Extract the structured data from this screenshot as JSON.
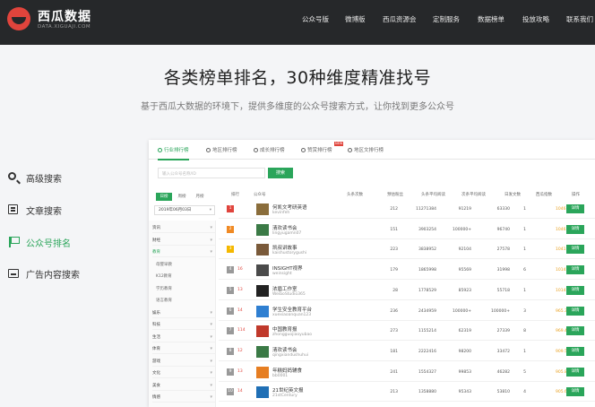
{
  "brand": {
    "name": "西瓜数据",
    "sub": "DATA.XIGUAJI.COM"
  },
  "nav": [
    "公众号版",
    "微博版",
    "西瓜资源会",
    "定制服务",
    "数据榜单",
    "投放攻略",
    "联系我们"
  ],
  "headline": "各类榜单排名，30种维度精准找号",
  "subline": "基于西瓜大数据的环境下，提供多维度的公众号搜索方式，让你找到更多公众号",
  "side_menu": [
    {
      "label": "高级搜索",
      "icon": "search-icon"
    },
    {
      "label": "文章搜索",
      "icon": "article-icon"
    },
    {
      "label": "公众号排名",
      "icon": "flag-icon",
      "active": true
    },
    {
      "label": "广告内容搜索",
      "icon": "ad-icon"
    }
  ],
  "panel": {
    "tabs": [
      "行业排行榜",
      "地区排行榜",
      "成长排行榜",
      "赞赏排行榜",
      "地区文排行榜"
    ],
    "hot_badge": "NEW",
    "search_placeholder": "输入公众号名称/ID",
    "search_button": "搜索",
    "period_tabs": [
      "日榜",
      "周榜",
      "月榜"
    ],
    "date": "2019年06月03日",
    "categories": [
      {
        "label": "资讯",
        "type": "cat"
      },
      {
        "label": "财经",
        "type": "cat"
      },
      {
        "label": "教育",
        "type": "cat",
        "active": true
      },
      {
        "label": "母婴早教",
        "type": "sub"
      },
      {
        "label": "K12教育",
        "type": "sub"
      },
      {
        "label": "学历教育",
        "type": "sub"
      },
      {
        "label": "语言教育",
        "type": "sub"
      },
      {
        "label": "娱乐",
        "type": "cat"
      },
      {
        "label": "科技",
        "type": "cat"
      },
      {
        "label": "生活",
        "type": "cat"
      },
      {
        "label": "体育",
        "type": "cat"
      },
      {
        "label": "游戏",
        "type": "cat"
      },
      {
        "label": "文化",
        "type": "cat"
      },
      {
        "label": "美食",
        "type": "cat"
      },
      {
        "label": "情感",
        "type": "cat"
      }
    ],
    "columns": [
      "排行",
      "公众号",
      "头条次数",
      "预估粉丝",
      "头条平均阅读",
      "次条平均阅读",
      "日发文数",
      "西瓜指数",
      "操作"
    ],
    "rows": [
      {
        "rank": "1",
        "rank_color": "#e0443c",
        "name": "何凯文考研英语",
        "wx": "kevinfeh",
        "v1": "212",
        "v2": "11271384",
        "v3": "91219",
        "v4": "63330",
        "v5": "1",
        "idx": "1046.8",
        "av": "#8a6d3b"
      },
      {
        "rank": "2",
        "rank_color": "#f08a24",
        "name": "清欢读书会",
        "wx": "lingyugamn07",
        "v1": "151",
        "v2": "3903254",
        "v3": "100000+",
        "v4": "96740",
        "v5": "1",
        "idx": "1046.9",
        "av": "#3b7a46"
      },
      {
        "rank": "3",
        "rank_color": "#f5b800",
        "name": "凯叔讲故事",
        "wx": "kaishustorygushi",
        "v1": "223",
        "v2": "3838952",
        "v3": "92104",
        "v4": "27578",
        "v5": "1",
        "idx": "1041.1",
        "av": "#7a5a3a"
      },
      {
        "rank": "4",
        "rank_color": "#999999",
        "change": "16",
        "name": "INSIGHT视界",
        "wx": "weinsight",
        "v1": "179",
        "v2": "1865998",
        "v3": "95569",
        "v4": "31998",
        "v5": "6",
        "idx": "1014.0",
        "av": "#4a4a4a"
      },
      {
        "rank": "5",
        "rank_color": "#999999",
        "change": "13",
        "name": "浓眉工作室",
        "wx": "WeiboStudio365",
        "v1": "28",
        "v2": "1778529",
        "v3": "85923",
        "v4": "55718",
        "v5": "1",
        "idx": "1014.0",
        "av": "#222222"
      },
      {
        "rank": "6",
        "rank_color": "#999999",
        "change": "14",
        "name": "学生安全教育平台",
        "wx": "xuexiaoanquan123",
        "v1": "236",
        "v2": "2434959",
        "v3": "100000+",
        "v4": "100000+",
        "v5": "3",
        "idx": "965.3",
        "av": "#2f7fd1"
      },
      {
        "rank": "7",
        "rank_color": "#999999",
        "change": "114",
        "name": "中国教育报",
        "wx": "zhongguojiaoyubao",
        "v1": "273",
        "v2": "1155214",
        "v3": "62319",
        "v4": "27339",
        "v5": "8",
        "idx": "969.4",
        "av": "#c0392b"
      },
      {
        "rank": "8",
        "rank_color": "#999999",
        "change": "12",
        "name": "清欢读书会",
        "wx": "qingxiandushuhui",
        "v1": "181",
        "v2": "2222416",
        "v3": "98200",
        "v4": "33472",
        "v5": "1",
        "idx": "909.5",
        "av": "#3b7a46"
      },
      {
        "rank": "9",
        "rank_color": "#999999",
        "change": "13",
        "name": "年糕妈妈辅食",
        "wx": "bb0001",
        "v1": "241",
        "v2": "1554327",
        "v3": "99853",
        "v4": "46282",
        "v5": "5",
        "idx": "905.8",
        "av": "#e67e22"
      },
      {
        "rank": "10",
        "rank_color": "#999999",
        "change": "14",
        "name": "21世纪英文报",
        "wx": "21stCentury",
        "v1": "213",
        "v2": "1358880",
        "v3": "95343",
        "v4": "53810",
        "v5": "4",
        "idx": "905.6",
        "av": "#1f6fb5"
      }
    ],
    "detail_label": "详情"
  },
  "colors": {
    "accent": "#2aa55a",
    "topbar": "#26282a",
    "brand_red": "#e0443c",
    "index": "#e8a020"
  }
}
